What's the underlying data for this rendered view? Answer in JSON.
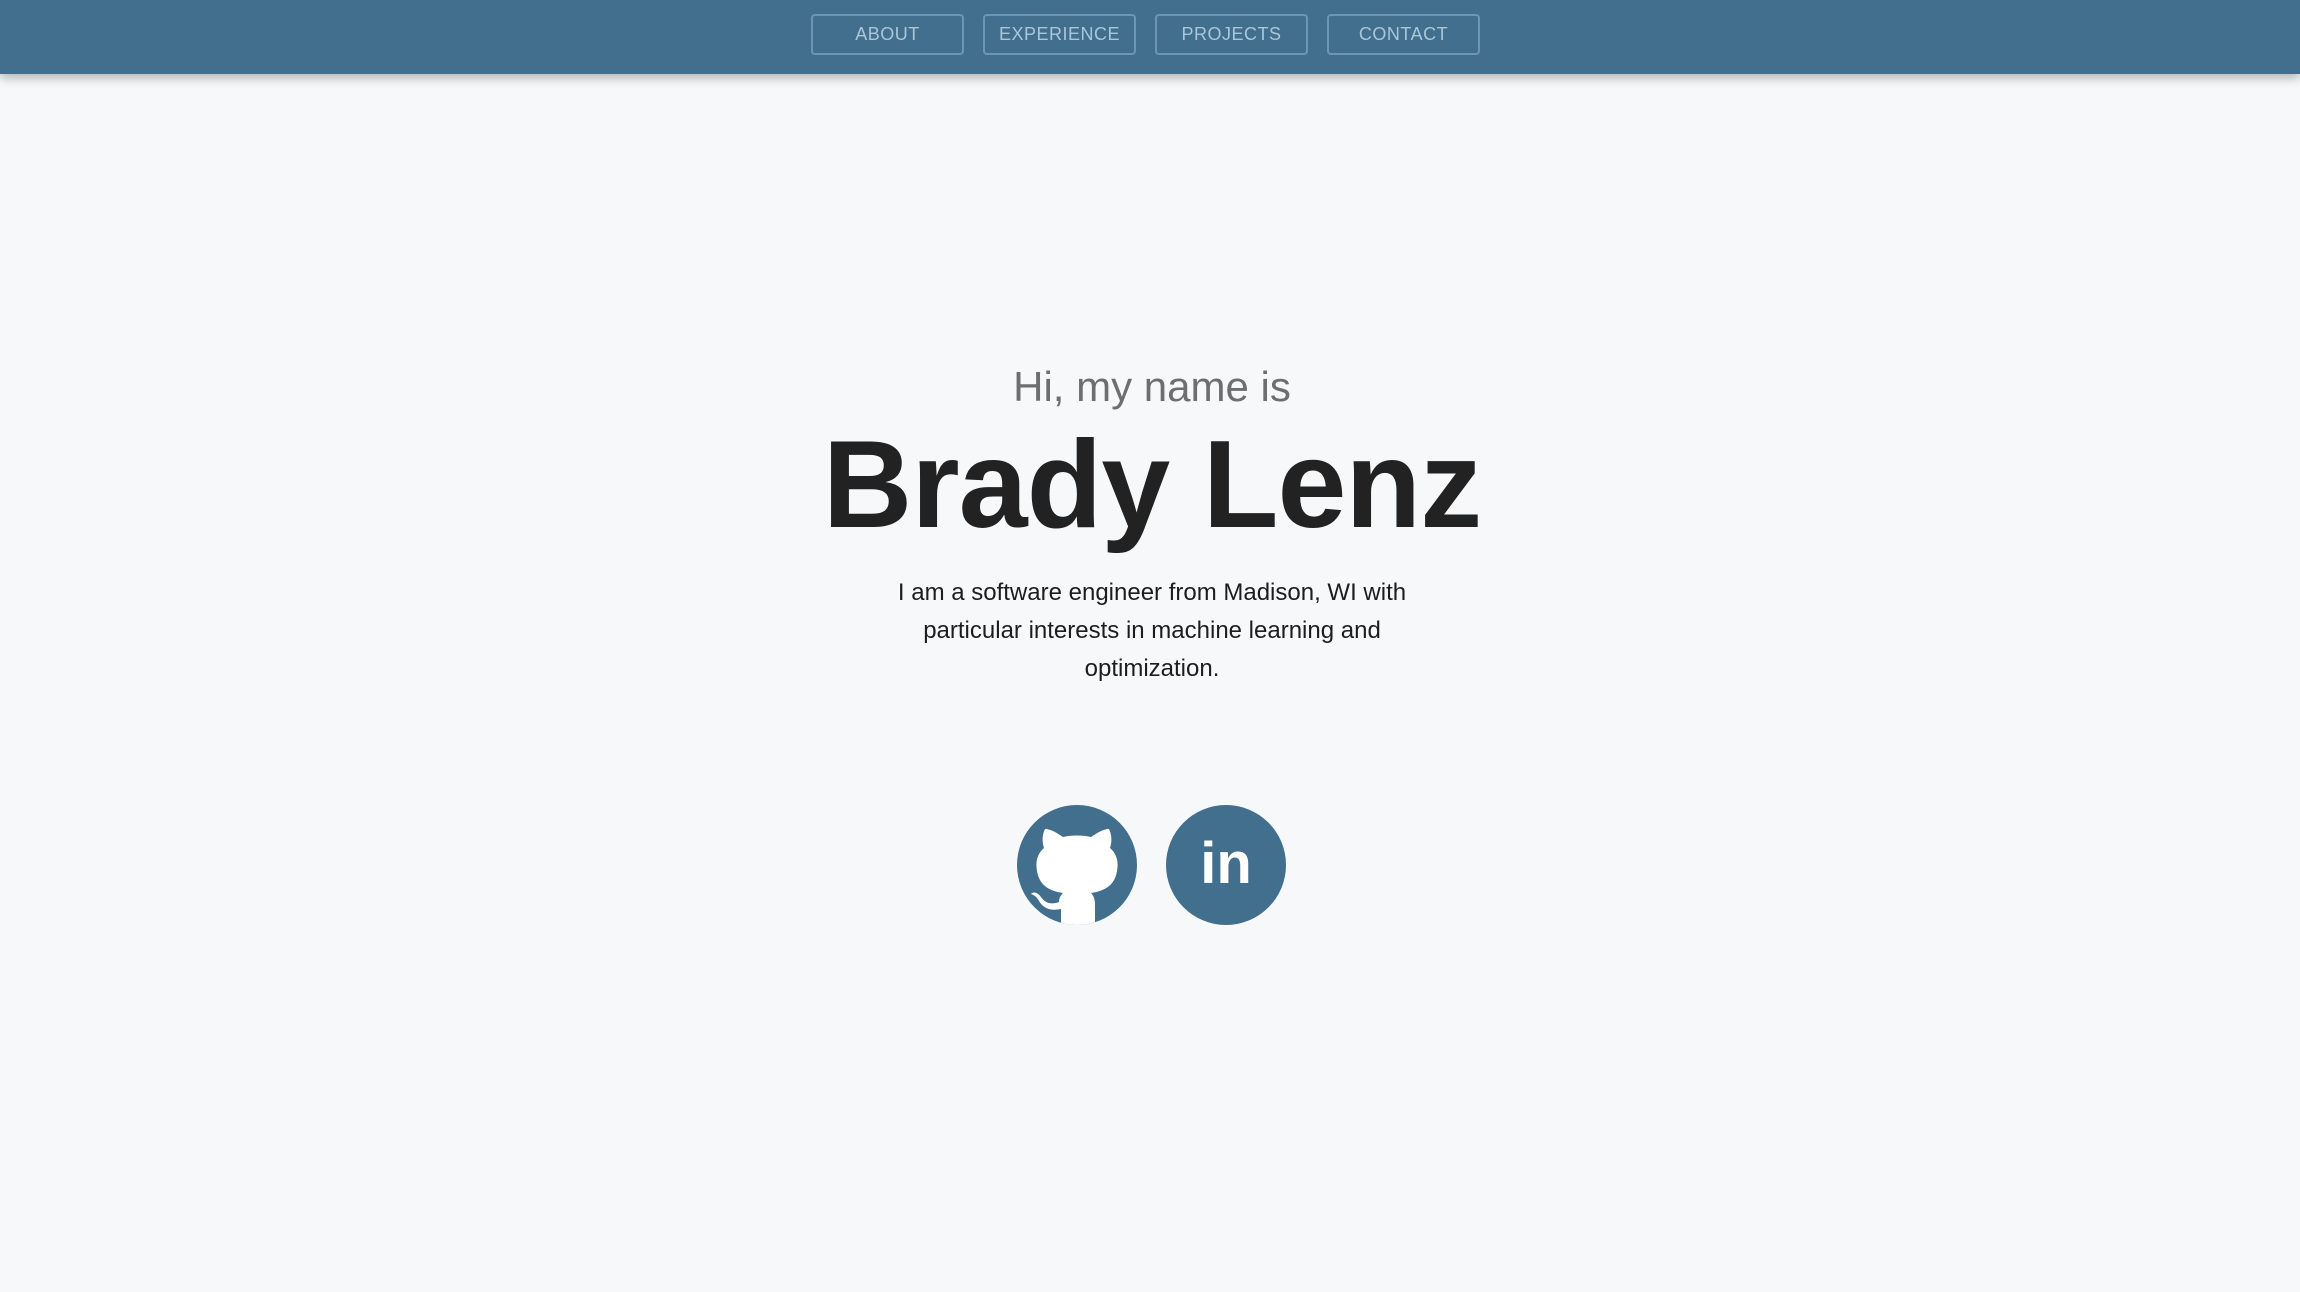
{
  "nav": {
    "items": [
      {
        "label": "ABOUT"
      },
      {
        "label": "EXPERIENCE"
      },
      {
        "label": "PROJECTS"
      },
      {
        "label": "CONTACT"
      }
    ]
  },
  "hero": {
    "greeting": "Hi, my name is",
    "name": "Brady Lenz",
    "intro": "I am a software engineer from Madison, WI with particular interests in machine learning and optimization."
  },
  "socials": {
    "github_icon": "github-icon",
    "linkedin_icon": "linkedin-icon",
    "linkedin_text": "in"
  },
  "colors": {
    "accent": "#426f8e",
    "background": "#f7f8fa",
    "nav_text": "#a9c6da"
  }
}
